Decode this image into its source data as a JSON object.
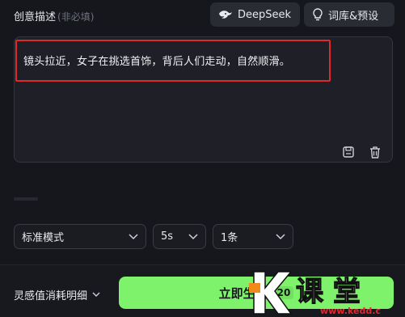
{
  "header": {
    "title": "创意描述",
    "title_hint": "(非必填)",
    "deepseek_label": "DeepSeek",
    "library_label": "词库&预设"
  },
  "prompt": {
    "text": "镜头拉近，女子在挑选首饰，背后人们走动，自然顺滑。"
  },
  "options": {
    "mode": "标准模式",
    "duration": "5s",
    "count": "1条"
  },
  "footer": {
    "cost_label": "灵感值消耗明细",
    "generate_label": "立即生成",
    "generate_cost": "20"
  },
  "watermark": {
    "brand": "课 堂",
    "url": "www.kedd.c"
  },
  "colors": {
    "accent_green": "#7df26a",
    "highlight_red": "#e0292c",
    "background": "#16171c"
  }
}
